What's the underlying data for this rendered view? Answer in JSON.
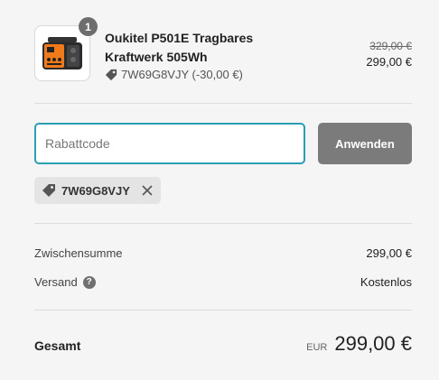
{
  "line_item": {
    "quantity": "1",
    "title": "Oukitel P501E Tragbares Kraftwerk 505Wh",
    "discount_applied": "7W69G8VJY (-30,00 €)",
    "original_price": "329,00 €",
    "price": "299,00 €",
    "thumbnail_icon": "power-station-icon"
  },
  "discount_form": {
    "placeholder": "Rabattcode",
    "apply_label": "Anwenden"
  },
  "applied_code": {
    "code": "7W69G8VJY",
    "tag_icon": "tag-icon",
    "remove_icon": "close-icon"
  },
  "summary": {
    "subtotal_label": "Zwischensumme",
    "subtotal_value": "299,00 €",
    "shipping_label": "Versand",
    "shipping_value": "Kostenlos",
    "shipping_help_icon": "question-circle-icon"
  },
  "total": {
    "label": "Gesamt",
    "currency": "EUR",
    "amount": "299,00 €"
  },
  "colors": {
    "input_focus": "#2b9eb3",
    "button_bg": "#7b7b7b",
    "chip_bg": "#e4e4e4",
    "background": "#f5f5f5"
  }
}
